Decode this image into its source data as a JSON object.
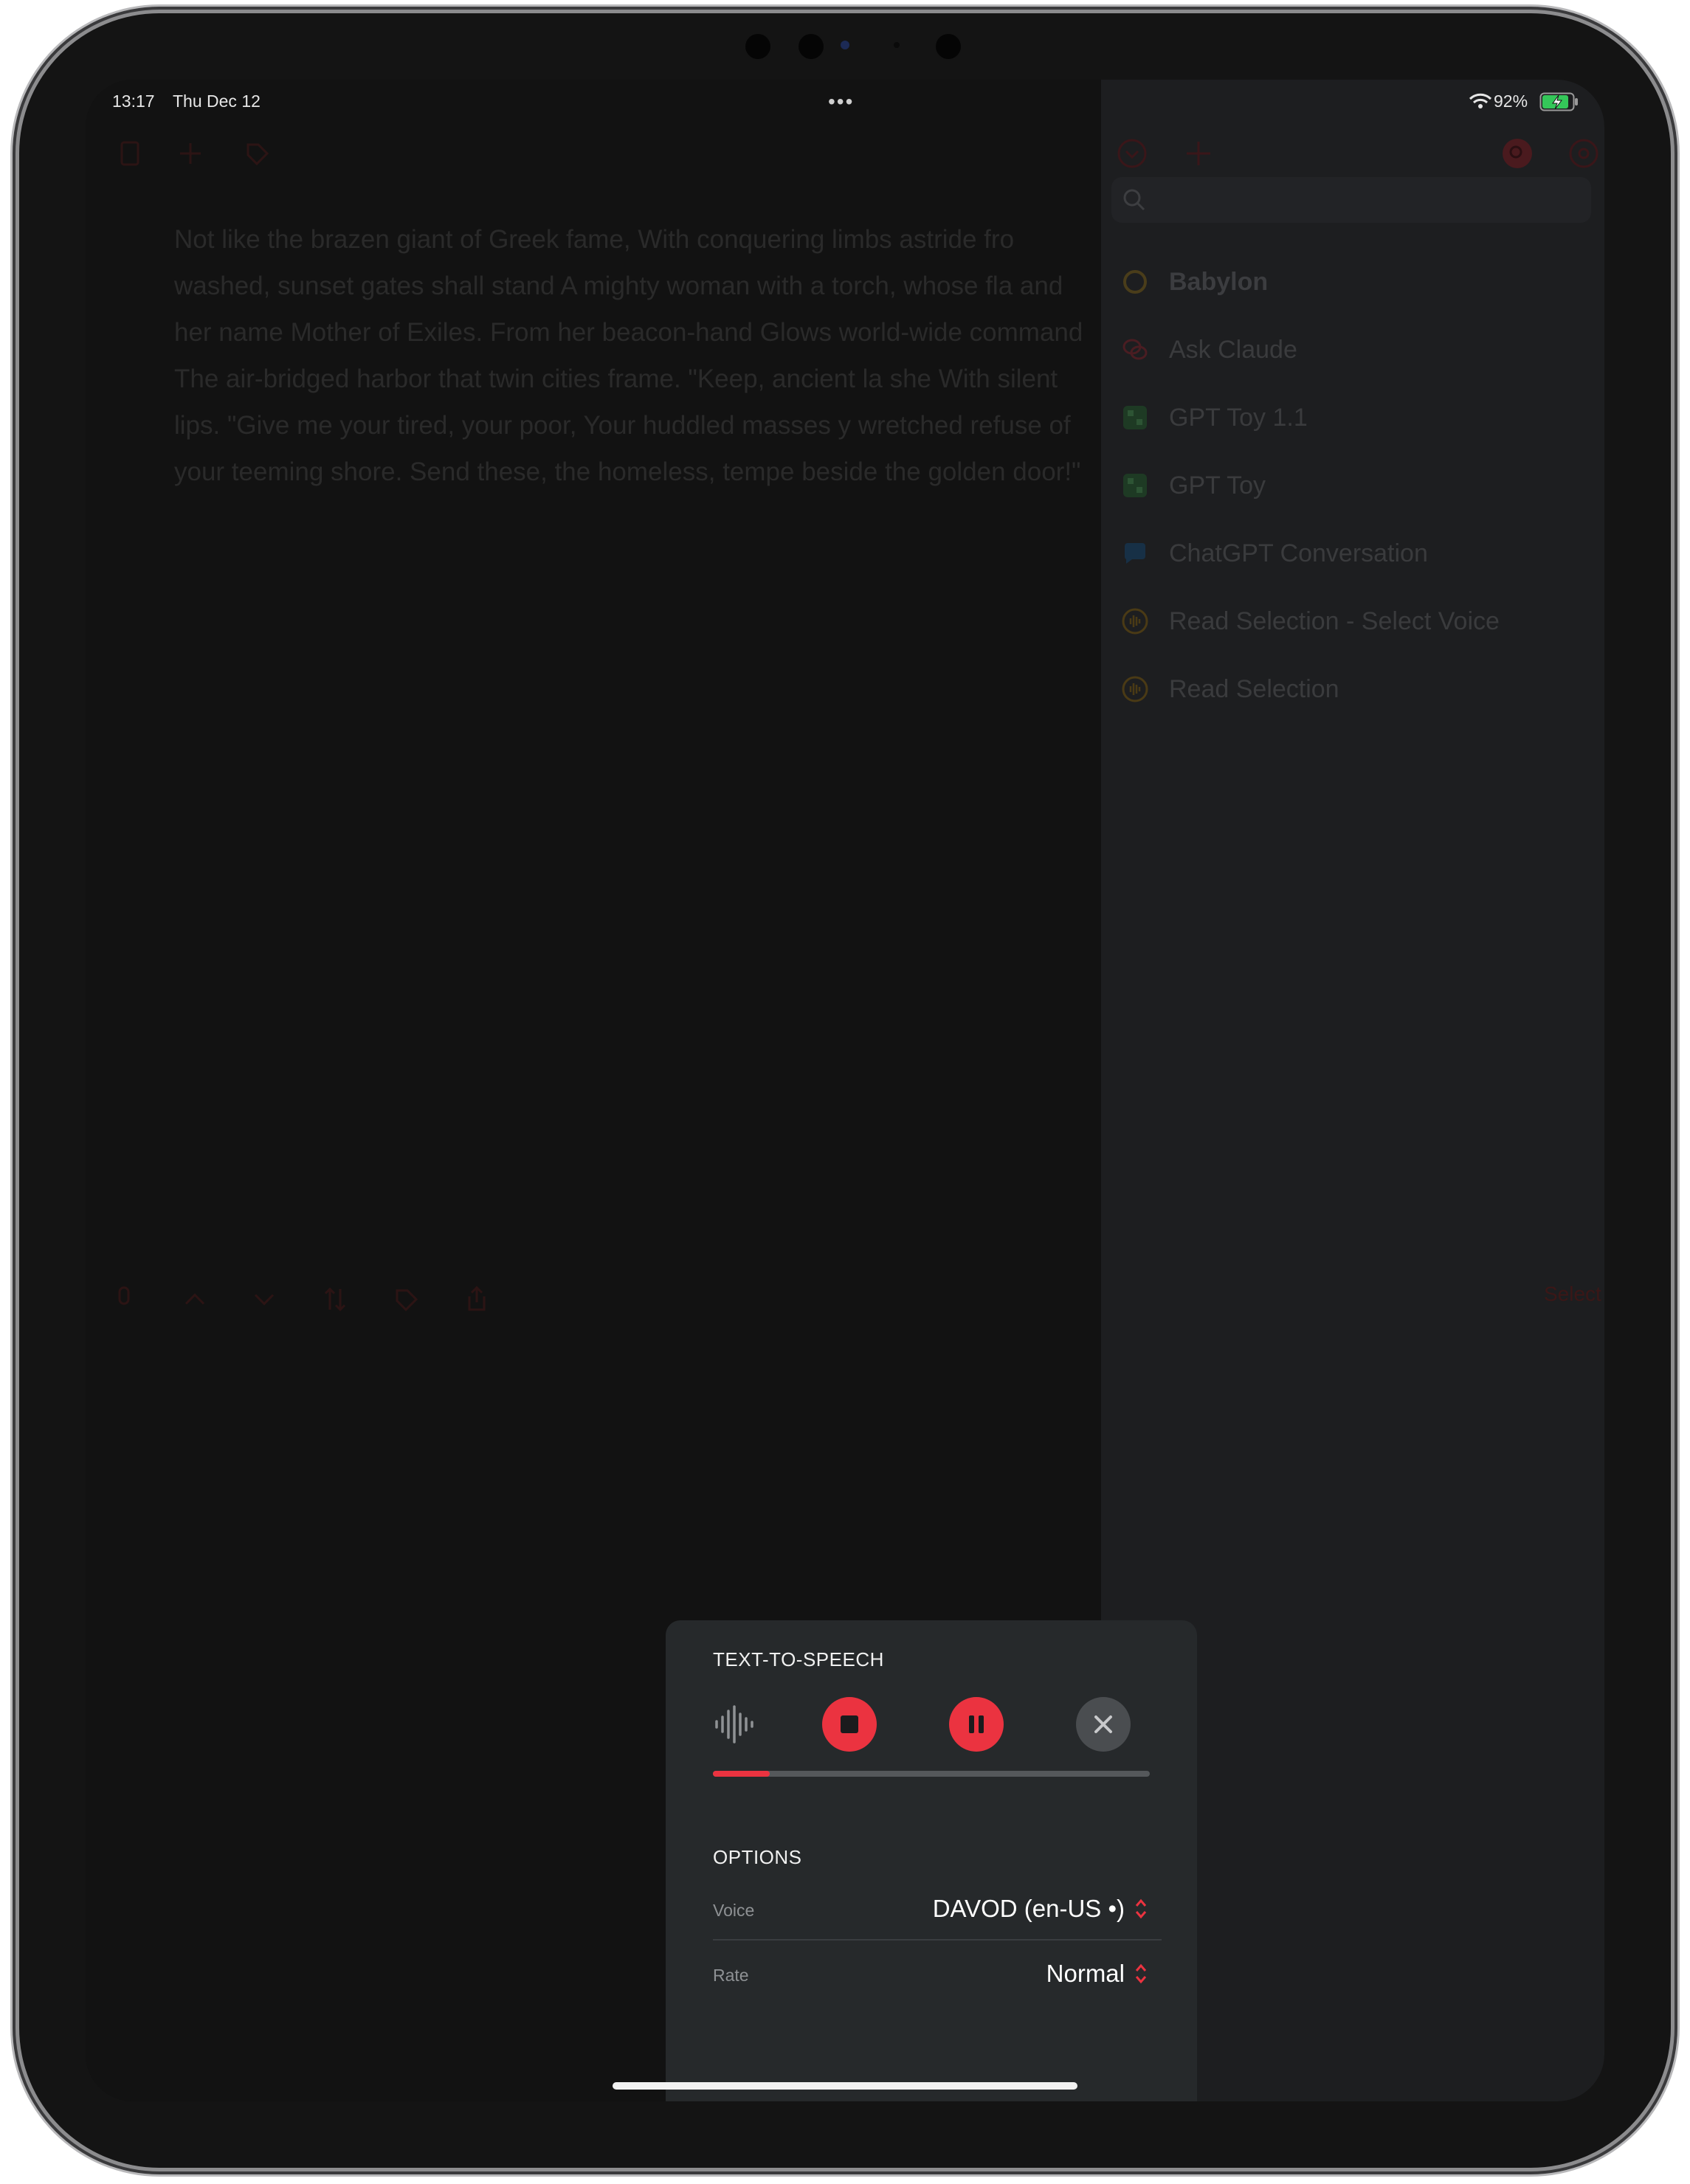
{
  "status_bar": {
    "time": "13:17",
    "date": "Thu Dec 12",
    "multitask_dots": "•••",
    "battery_percent": "92%",
    "battery_level": 0.92
  },
  "document": {
    "text": "Not like the brazen giant of Greek fame, With conquering limbs astride fro washed, sunset gates shall stand A mighty woman with a torch, whose fla and her name Mother of Exiles. From her beacon-hand Glows world-wide command The air-bridged harbor that twin cities frame. \"Keep, ancient la she With silent lips. \"Give me your tired, your poor, Your huddled masses y wretched refuse of your teeming shore. Send these, the homeless, tempe beside the golden door!\""
  },
  "sidebar": {
    "items": [
      {
        "label": "Babylon",
        "icon": "openai-icon",
        "color": "#5a4a1a"
      },
      {
        "label": "Ask Claude",
        "icon": "chat-bubbles-icon",
        "color": "#4a1d22"
      },
      {
        "label": "GPT Toy 1.1",
        "icon": "grid-app-icon",
        "color": "#1e3a24"
      },
      {
        "label": "GPT Toy",
        "icon": "grid-app-icon",
        "color": "#1e3a24"
      },
      {
        "label": "ChatGPT Conversation",
        "icon": "speech-bubble-icon",
        "color": "#173046"
      },
      {
        "label": "Read Selection - Select Voice",
        "icon": "waveform-icon",
        "color": "#4a3a15"
      },
      {
        "label": "Read Selection",
        "icon": "waveform-icon",
        "color": "#4a3a15"
      }
    ]
  },
  "bottom_toolbar": {
    "select_label": "Select"
  },
  "tts": {
    "title": "TEXT-TO-SPEECH",
    "progress": 0.13,
    "options_title": "OPTIONS",
    "voice_label": "Voice",
    "voice_value": "DAVOD (en-US •)",
    "rate_label": "Rate",
    "rate_value": "Normal",
    "accent_color": "#eb3340"
  }
}
